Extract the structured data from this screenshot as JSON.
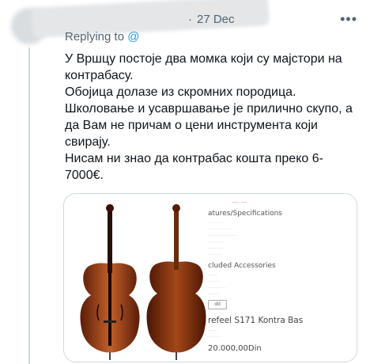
{
  "tweet": {
    "author_name": "",
    "date": "27 Dec",
    "more_icon": "more-icon",
    "reply_prefix": "Replying to",
    "reply_handle": "@",
    "body_lines": [
      "У Вршцу постоје два момка који су мајстори на контрабасу.",
      "Обојица долазе из скромних породица.",
      "Школовање и усавршавање је прилично скупо, а да Вам не причам о цени инструмента који свирају.",
      "Нисам ни знао да контрабас кошта преко 6-7000€."
    ]
  },
  "media": {
    "specs_heading": "atures/Specifications",
    "accessories_heading": "cluded Accessories",
    "product_title": "refeel S171 Kontra Bas",
    "price": "20.000,00Din",
    "add_label": "dd",
    "colors": {
      "wood_dark": "#5a1c08",
      "wood_mid": "#9a3d14",
      "wood_light": "#c2602a"
    }
  }
}
